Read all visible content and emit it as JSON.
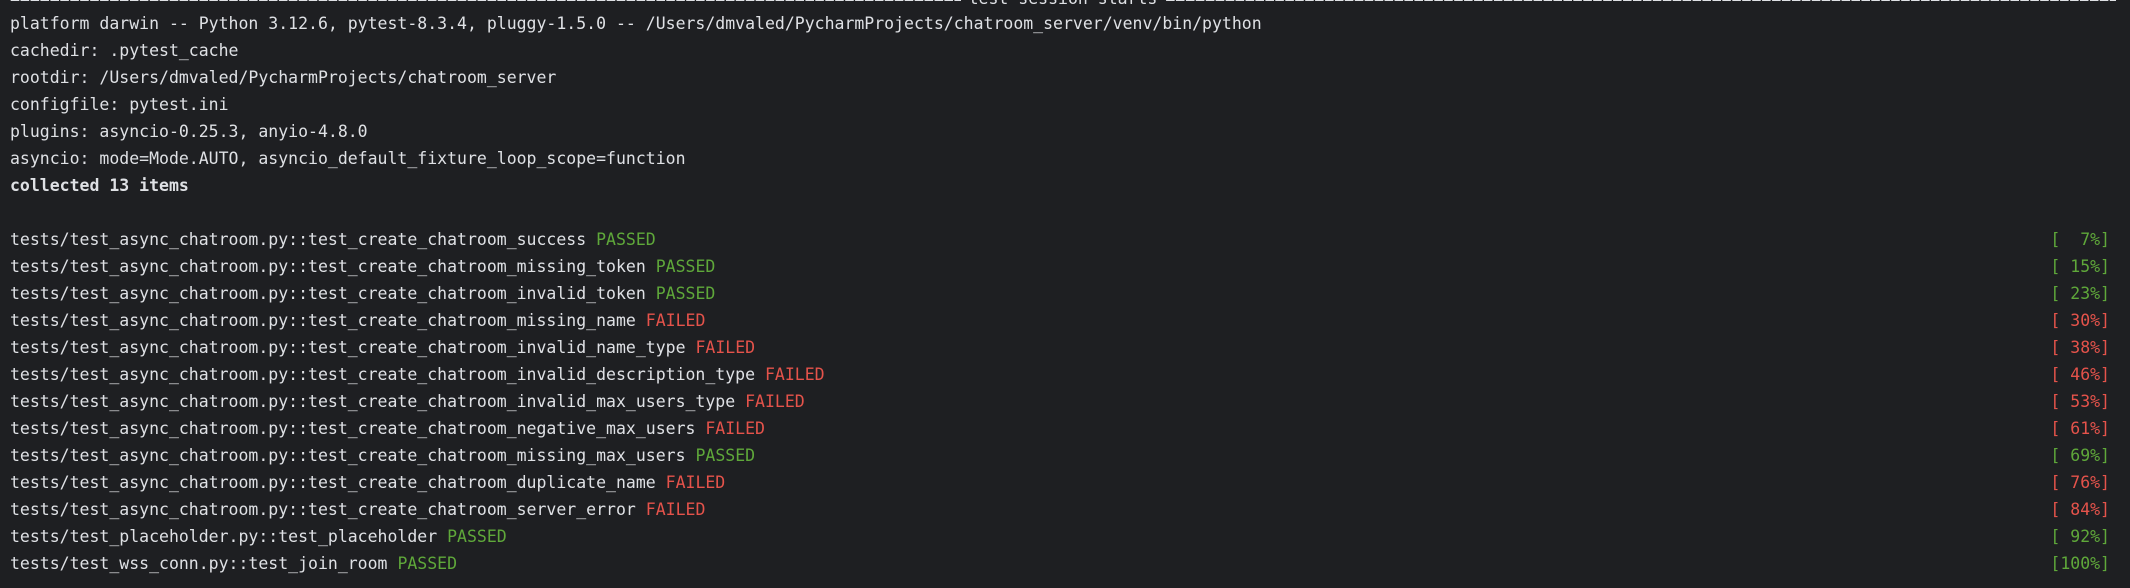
{
  "header": {
    "title": "test session starts",
    "dashes": "=================================================================================================================================================================================="
  },
  "session": {
    "platform": "platform darwin -- Python 3.12.6, pytest-8.3.4, pluggy-1.5.0 -- /Users/dmvaled/PycharmProjects/chatroom_server/venv/bin/python",
    "cachedir": "cachedir: .pytest_cache",
    "rootdir": "rootdir: /Users/dmvaled/PycharmProjects/chatroom_server",
    "configfile": "configfile: pytest.ini",
    "plugins": "plugins: asyncio-0.25.3, anyio-4.8.0",
    "asyncio": "asyncio: mode=Mode.AUTO, asyncio_default_fixture_loop_scope=function",
    "collected": "collected 13 items"
  },
  "colors": {
    "passed": "#5fa83a",
    "failed": "#e5534b",
    "background": "#1e1f22",
    "text": "#dfe1e5"
  },
  "results": [
    {
      "test": "tests/test_async_chatroom.py::test_create_chatroom_success",
      "status": "PASSED",
      "progress": "[  7%]"
    },
    {
      "test": "tests/test_async_chatroom.py::test_create_chatroom_missing_token",
      "status": "PASSED",
      "progress": "[ 15%]"
    },
    {
      "test": "tests/test_async_chatroom.py::test_create_chatroom_invalid_token",
      "status": "PASSED",
      "progress": "[ 23%]"
    },
    {
      "test": "tests/test_async_chatroom.py::test_create_chatroom_missing_name",
      "status": "FAILED",
      "progress": "[ 30%]"
    },
    {
      "test": "tests/test_async_chatroom.py::test_create_chatroom_invalid_name_type",
      "status": "FAILED",
      "progress": "[ 38%]"
    },
    {
      "test": "tests/test_async_chatroom.py::test_create_chatroom_invalid_description_type",
      "status": "FAILED",
      "progress": "[ 46%]"
    },
    {
      "test": "tests/test_async_chatroom.py::test_create_chatroom_invalid_max_users_type",
      "status": "FAILED",
      "progress": "[ 53%]"
    },
    {
      "test": "tests/test_async_chatroom.py::test_create_chatroom_negative_max_users",
      "status": "FAILED",
      "progress": "[ 61%]"
    },
    {
      "test": "tests/test_async_chatroom.py::test_create_chatroom_missing_max_users",
      "status": "PASSED",
      "progress": "[ 69%]"
    },
    {
      "test": "tests/test_async_chatroom.py::test_create_chatroom_duplicate_name",
      "status": "FAILED",
      "progress": "[ 76%]"
    },
    {
      "test": "tests/test_async_chatroom.py::test_create_chatroom_server_error",
      "status": "FAILED",
      "progress": "[ 84%]"
    },
    {
      "test": "tests/test_placeholder.py::test_placeholder",
      "status": "PASSED",
      "progress": "[ 92%]"
    },
    {
      "test": "tests/test_wss_conn.py::test_join_room",
      "status": "PASSED",
      "progress": "[100%]"
    }
  ]
}
